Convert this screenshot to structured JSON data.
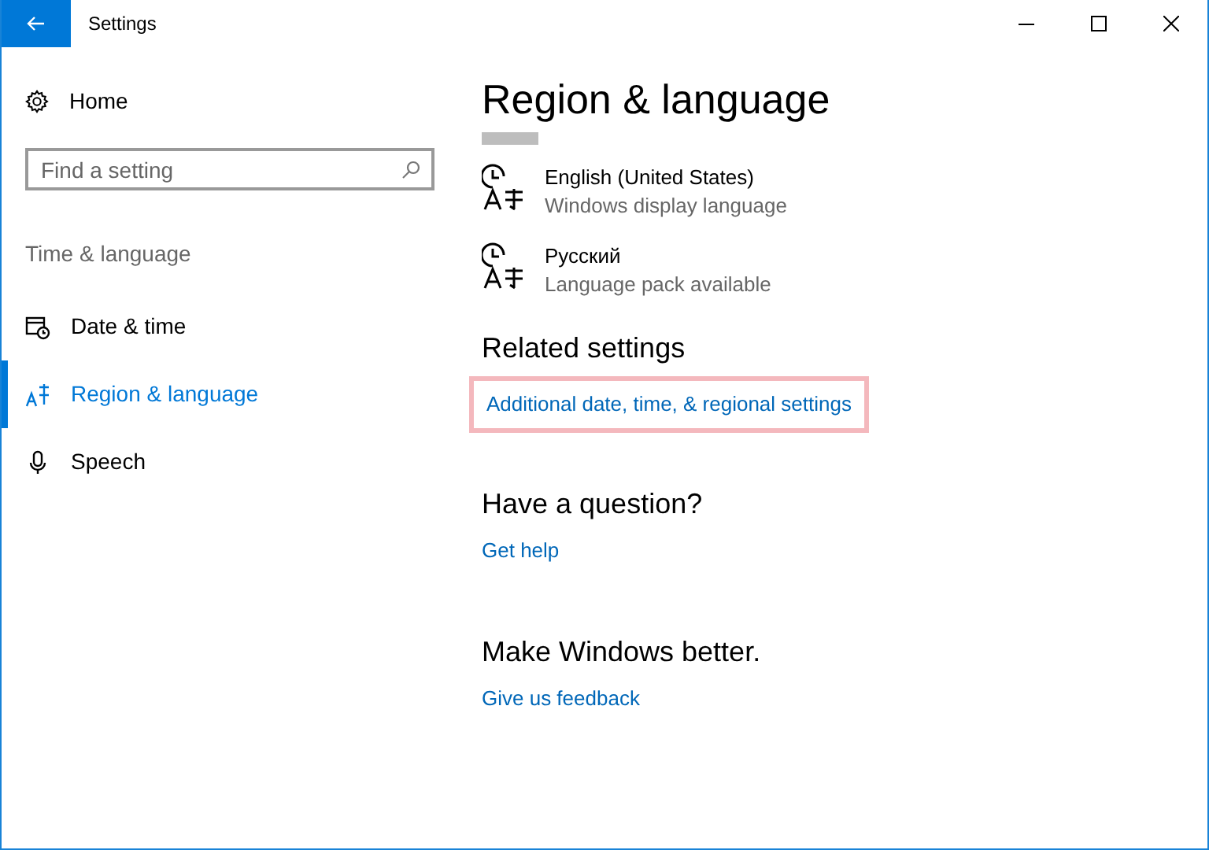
{
  "window": {
    "title": "Settings"
  },
  "sidebar": {
    "home": "Home",
    "search": {
      "placeholder": "Find a setting"
    },
    "section": "Time & language",
    "items": [
      {
        "label": "Date & time",
        "kind": "calendar",
        "selected": false
      },
      {
        "label": "Region & language",
        "kind": "region",
        "selected": true
      },
      {
        "label": "Speech",
        "kind": "mic",
        "selected": false
      }
    ]
  },
  "main": {
    "title": "Region & language",
    "languages": [
      {
        "name": "English (United States)",
        "status": "Windows display language"
      },
      {
        "name": "Русский",
        "status": "Language pack available"
      }
    ],
    "related": {
      "heading": "Related settings",
      "links": [
        {
          "label": "Additional date, time, & regional settings",
          "highlighted": true
        }
      ]
    },
    "question": {
      "heading": "Have a question?",
      "link": "Get help"
    },
    "feedback": {
      "heading": "Make Windows better.",
      "link": "Give us feedback"
    }
  }
}
